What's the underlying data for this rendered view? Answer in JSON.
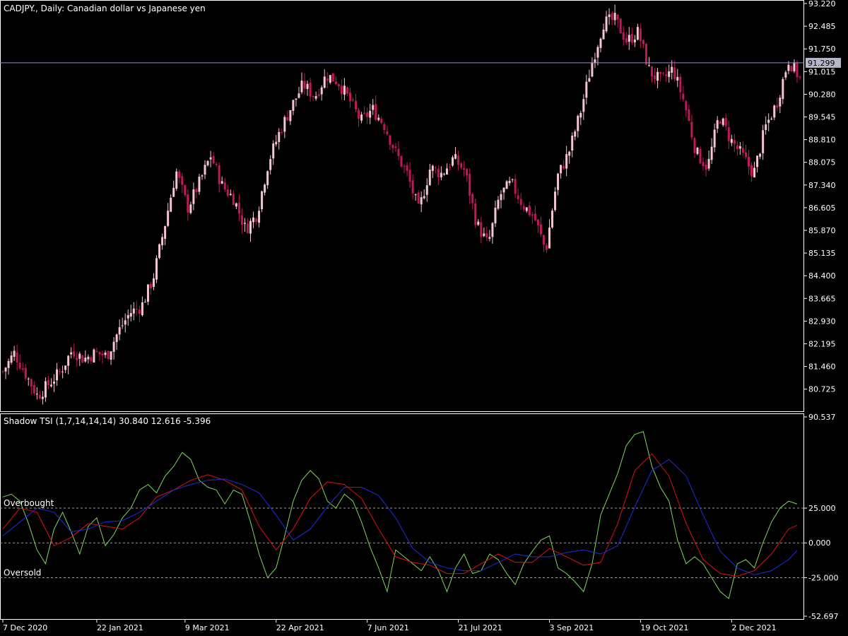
{
  "colors": {
    "background": "#000000",
    "frame": "#ffffff",
    "candle_up": "#f5c6cf",
    "candle_down": "#c2185b",
    "price_line": "#8f96b8",
    "price_label_bg": "#b4b8c8",
    "tsi_green": "#7cd65a",
    "tsi_red": "#e01010",
    "tsi_blue": "#1a2fe0",
    "level_line": "#a0a0a0"
  },
  "chart_data": [
    {
      "type": "candlestick",
      "title": "CADJPY., Daily:  Canadian dollar vs Japanese yen",
      "ylim": [
        80.1,
        93.22
      ],
      "y_ticks": [
        "93.220",
        "92.485",
        "91.750",
        "91.015",
        "90.280",
        "89.545",
        "88.810",
        "88.075",
        "87.340",
        "86.605",
        "85.870",
        "85.135",
        "84.400",
        "83.665",
        "82.930",
        "82.195",
        "81.460",
        "80.725"
      ],
      "current_price": 91.299,
      "current_price_label": "91.299",
      "close_path": [
        [
          "7 Dec 2020",
          81.3
        ],
        [
          "2020-12-11",
          81.9
        ],
        [
          "2020-12-18",
          81.2
        ],
        [
          "2020-12-23",
          80.5
        ],
        [
          "2020-12-30",
          80.9
        ],
        [
          "2021-01-06",
          81.3
        ],
        [
          "2021-01-11",
          82.0
        ],
        [
          "2021-01-15",
          81.7
        ],
        [
          "22 Jan 2021",
          81.9
        ],
        [
          "2021-01-29",
          81.8
        ],
        [
          "2021-02-05",
          82.6
        ],
        [
          "2021-02-12",
          83.2
        ],
        [
          "2021-02-19",
          83.4
        ],
        [
          "2021-02-24",
          84.3
        ],
        [
          "9 Mar 2021",
          86.0
        ],
        [
          "2021-03-12",
          87.8
        ],
        [
          "2021-03-19",
          86.6
        ],
        [
          "2021-03-26",
          87.4
        ],
        [
          "2021-03-31",
          88.3
        ],
        [
          "2021-04-07",
          87.3
        ],
        [
          "2021-04-14",
          86.9
        ],
        [
          "2021-04-19",
          85.9
        ],
        [
          "22 Apr 2021",
          86.4
        ],
        [
          "2021-04-28",
          88.1
        ],
        [
          "2021-05-05",
          89.1
        ],
        [
          "2021-05-12",
          89.9
        ],
        [
          "2021-05-19",
          90.6
        ],
        [
          "2021-05-24",
          90.2
        ],
        [
          "2021-05-28",
          90.9
        ],
        [
          "7 Jun 2021",
          90.7
        ],
        [
          "2021-06-14",
          90.1
        ],
        [
          "2021-06-18",
          89.4
        ],
        [
          "2021-06-25",
          89.8
        ],
        [
          "2021-07-02",
          89.3
        ],
        [
          "2021-07-09",
          88.4
        ],
        [
          "2021-07-14",
          87.7
        ],
        [
          "2021-07-19",
          86.5
        ],
        [
          "21 Jul 2021",
          87.9
        ],
        [
          "2021-07-28",
          87.7
        ],
        [
          "2021-08-04",
          88.2
        ],
        [
          "2021-08-11",
          87.8
        ],
        [
          "2021-08-17",
          86.1
        ],
        [
          "2021-08-20",
          85.4
        ],
        [
          "2021-08-25",
          87.0
        ],
        [
          "2021-09-01",
          87.4
        ],
        [
          "2021-09-03",
          86.7
        ],
        [
          "3 Sep 2021",
          86.3
        ],
        [
          "2021-09-10",
          85.2
        ],
        [
          "2021-09-15",
          87.6
        ],
        [
          "2021-09-22",
          88.4
        ],
        [
          "2021-09-29",
          89.7
        ],
        [
          "2021-10-06",
          91.3
        ],
        [
          "2021-10-13",
          92.6
        ],
        [
          "19 Oct 2021",
          92.7
        ],
        [
          "2021-10-22",
          92.0
        ],
        [
          "2021-10-27",
          92.3
        ],
        [
          "2021-11-01",
          91.0
        ],
        [
          "2021-11-08",
          90.7
        ],
        [
          "2021-11-12",
          91.1
        ],
        [
          "2021-11-17",
          90.0
        ],
        [
          "2021-11-24",
          88.4
        ],
        [
          "2021-11-29",
          87.9
        ],
        [
          "2 Dec 2021",
          89.6
        ],
        [
          "2021-12-08",
          88.8
        ],
        [
          "2021-12-13",
          88.3
        ],
        [
          "2021-12-16",
          87.7
        ],
        [
          "2021-12-21",
          89.2
        ],
        [
          "2021-12-28",
          90.0
        ],
        [
          "2022-01-04",
          91.4
        ],
        [
          "2022-01-07",
          90.8
        ]
      ]
    },
    {
      "type": "line",
      "title": "Shadow TSI (1,7,14,14,14) 30.840 12.616 -5.396",
      "ylim": [
        -52.697,
        90.537
      ],
      "y_ticks": [
        {
          "v": 90.537,
          "label": "90.537"
        },
        {
          "v": 25,
          "label": "25.000"
        },
        {
          "v": 0,
          "label": "0.000"
        },
        {
          "v": -25,
          "label": "-25.000"
        },
        {
          "v": -52.697,
          "label": "-52.697"
        }
      ],
      "levels": [
        {
          "name": "Overbought",
          "value": 25,
          "label": "Overbought"
        },
        {
          "value": 0,
          "label": ""
        },
        {
          "name": "Oversold",
          "value": -25,
          "label": "Oversold"
        }
      ],
      "x_index_range": [
        0,
        280
      ],
      "series": [
        {
          "color": "#7cd65a",
          "points": [
            [
              0,
              33
            ],
            [
              3,
              35
            ],
            [
              6,
              30
            ],
            [
              9,
              14
            ],
            [
              12,
              -5
            ],
            [
              15,
              -15
            ],
            [
              18,
              10
            ],
            [
              21,
              22
            ],
            [
              24,
              8
            ],
            [
              27,
              -8
            ],
            [
              30,
              12
            ],
            [
              33,
              18
            ],
            [
              36,
              -2
            ],
            [
              39,
              6
            ],
            [
              42,
              18
            ],
            [
              45,
              25
            ],
            [
              48,
              38
            ],
            [
              51,
              42
            ],
            [
              54,
              36
            ],
            [
              57,
              48
            ],
            [
              60,
              55
            ],
            [
              63,
              65
            ],
            [
              66,
              60
            ],
            [
              69,
              45
            ],
            [
              72,
              40
            ],
            [
              75,
              38
            ],
            [
              78,
              28
            ],
            [
              81,
              38
            ],
            [
              84,
              35
            ],
            [
              87,
              15
            ],
            [
              90,
              -8
            ],
            [
              93,
              -25
            ],
            [
              96,
              -18
            ],
            [
              99,
              5
            ],
            [
              102,
              30
            ],
            [
              105,
              45
            ],
            [
              108,
              52
            ],
            [
              111,
              46
            ],
            [
              114,
              30
            ],
            [
              117,
              25
            ],
            [
              120,
              35
            ],
            [
              123,
              30
            ],
            [
              126,
              15
            ],
            [
              129,
              -3
            ],
            [
              132,
              -18
            ],
            [
              135,
              -35
            ],
            [
              138,
              -5
            ],
            [
              141,
              -10
            ],
            [
              144,
              -15
            ],
            [
              147,
              -20
            ],
            [
              150,
              -10
            ],
            [
              153,
              -20
            ],
            [
              156,
              -35
            ],
            [
              159,
              -18
            ],
            [
              162,
              -8
            ],
            [
              165,
              -22
            ],
            [
              168,
              -20
            ],
            [
              171,
              -8
            ],
            [
              174,
              -12
            ],
            [
              177,
              -22
            ],
            [
              180,
              -30
            ],
            [
              183,
              -15
            ],
            [
              186,
              -6
            ],
            [
              189,
              2
            ],
            [
              192,
              5
            ],
            [
              195,
              -18
            ],
            [
              198,
              -22
            ],
            [
              201,
              -28
            ],
            [
              204,
              -35
            ],
            [
              207,
              -15
            ],
            [
              210,
              20
            ],
            [
              213,
              35
            ],
            [
              216,
              50
            ],
            [
              219,
              70
            ],
            [
              222,
              78
            ],
            [
              225,
              80
            ],
            [
              228,
              55
            ],
            [
              231,
              40
            ],
            [
              234,
              30
            ],
            [
              237,
              2
            ],
            [
              240,
              -15
            ],
            [
              243,
              -10
            ],
            [
              246,
              -15
            ],
            [
              249,
              -25
            ],
            [
              252,
              -35
            ],
            [
              255,
              -40
            ],
            [
              258,
              -15
            ],
            [
              261,
              -12
            ],
            [
              264,
              -18
            ],
            [
              267,
              0
            ],
            [
              270,
              15
            ],
            [
              273,
              25
            ],
            [
              276,
              30
            ],
            [
              279,
              28
            ]
          ]
        },
        {
          "color": "#e01010",
          "points": [
            [
              0,
              10
            ],
            [
              6,
              25
            ],
            [
              12,
              22
            ],
            [
              18,
              -2
            ],
            [
              24,
              4
            ],
            [
              30,
              14
            ],
            [
              36,
              12
            ],
            [
              42,
              10
            ],
            [
              48,
              18
            ],
            [
              54,
              33
            ],
            [
              60,
              38
            ],
            [
              66,
              45
            ],
            [
              72,
              49
            ],
            [
              78,
              45
            ],
            [
              84,
              38
            ],
            [
              90,
              12
            ],
            [
              96,
              -5
            ],
            [
              102,
              10
            ],
            [
              108,
              32
            ],
            [
              114,
              44
            ],
            [
              120,
              42
            ],
            [
              126,
              32
            ],
            [
              132,
              10
            ],
            [
              138,
              -10
            ],
            [
              144,
              -14
            ],
            [
              150,
              -16
            ],
            [
              156,
              -22
            ],
            [
              162,
              -22
            ],
            [
              168,
              -15
            ],
            [
              174,
              -8
            ],
            [
              180,
              -14
            ],
            [
              186,
              -14
            ],
            [
              192,
              -4
            ],
            [
              198,
              -10
            ],
            [
              204,
              -16
            ],
            [
              210,
              -14
            ],
            [
              216,
              14
            ],
            [
              222,
              52
            ],
            [
              228,
              64
            ],
            [
              234,
              48
            ],
            [
              240,
              14
            ],
            [
              246,
              -12
            ],
            [
              252,
              -22
            ],
            [
              258,
              -24
            ],
            [
              264,
              -20
            ],
            [
              270,
              -8
            ],
            [
              276,
              10
            ],
            [
              279,
              12.616
            ]
          ]
        },
        {
          "color": "#1a2fe0",
          "points": [
            [
              0,
              5
            ],
            [
              6,
              15
            ],
            [
              12,
              25
            ],
            [
              18,
              22
            ],
            [
              24,
              8
            ],
            [
              30,
              10
            ],
            [
              36,
              15
            ],
            [
              42,
              16
            ],
            [
              48,
              22
            ],
            [
              54,
              30
            ],
            [
              60,
              38
            ],
            [
              66,
              42
            ],
            [
              72,
              45
            ],
            [
              78,
              46
            ],
            [
              84,
              42
            ],
            [
              90,
              36
            ],
            [
              96,
              20
            ],
            [
              102,
              2
            ],
            [
              108,
              10
            ],
            [
              114,
              26
            ],
            [
              120,
              40
            ],
            [
              126,
              40
            ],
            [
              132,
              34
            ],
            [
              138,
              18
            ],
            [
              144,
              -4
            ],
            [
              150,
              -14
            ],
            [
              156,
              -18
            ],
            [
              162,
              -20
            ],
            [
              168,
              -20
            ],
            [
              174,
              -14
            ],
            [
              180,
              -8
            ],
            [
              186,
              -10
            ],
            [
              192,
              -10
            ],
            [
              198,
              -7
            ],
            [
              204,
              -5
            ],
            [
              210,
              -8
            ],
            [
              216,
              -2
            ],
            [
              222,
              26
            ],
            [
              228,
              52
            ],
            [
              234,
              60
            ],
            [
              240,
              48
            ],
            [
              246,
              20
            ],
            [
              252,
              -6
            ],
            [
              258,
              -18
            ],
            [
              264,
              -23
            ],
            [
              270,
              -20
            ],
            [
              276,
              -12
            ],
            [
              279,
              -5.396
            ]
          ]
        }
      ]
    }
  ],
  "x_axis": {
    "tick_labels": [
      "7 Dec 2020",
      "22 Jan 2021",
      "9 Mar 2021",
      "22 Apr 2021",
      "7 Jun 2021",
      "21 Jul 2021",
      "3 Sep 2021",
      "19 Oct 2021",
      "2 Dec 2021"
    ],
    "tick_index": [
      0,
      33,
      64,
      96,
      128,
      160,
      192,
      224,
      256
    ]
  }
}
